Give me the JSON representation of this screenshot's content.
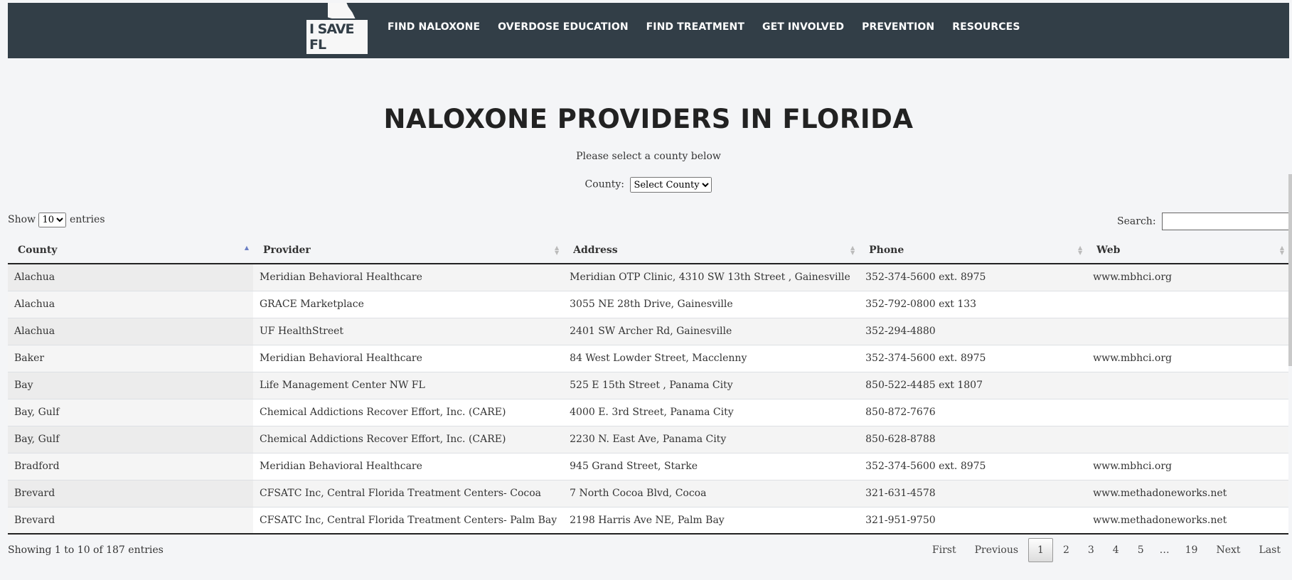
{
  "nav": {
    "logo_text": "I SAVE FL",
    "links": [
      {
        "label": "FIND NALOXONE"
      },
      {
        "label": "OVERDOSE EDUCATION"
      },
      {
        "label": "FIND TREATMENT"
      },
      {
        "label": "GET INVOLVED"
      },
      {
        "label": "PREVENTION"
      },
      {
        "label": "RESOURCES"
      }
    ]
  },
  "main": {
    "title": "NALOXONE PROVIDERS IN FLORIDA",
    "subtitle": "Please select a county below",
    "county_label": "County:",
    "county_selected": "Select County"
  },
  "table_controls": {
    "show_label": "Show",
    "entries_label": "entries",
    "length_selected": "10",
    "search_label": "Search:",
    "search_value": ""
  },
  "table": {
    "columns": [
      "County",
      "Provider",
      "Address",
      "Phone",
      "Web"
    ],
    "rows": [
      [
        "Alachua",
        "Meridian Behavioral Healthcare",
        "Meridian OTP Clinic, 4310 SW 13th Street , Gainesville",
        "352-374-5600 ext. 8975",
        "www.mbhci.org"
      ],
      [
        "Alachua",
        "GRACE Marketplace",
        "3055 NE 28th Drive, Gainesville",
        "352-792-0800 ext 133",
        ""
      ],
      [
        "Alachua",
        "UF HealthStreet",
        "2401 SW Archer Rd, Gainesville",
        "352-294-4880",
        ""
      ],
      [
        "Baker",
        "Meridian Behavioral Healthcare",
        "84 West Lowder Street, Macclenny",
        "352-374-5600 ext. 8975",
        "www.mbhci.org"
      ],
      [
        "Bay",
        "Life Management Center NW FL",
        "525 E 15th Street , Panama City",
        "850-522-4485 ext 1807",
        ""
      ],
      [
        "Bay, Gulf",
        "Chemical Addictions Recover Effort, Inc. (CARE)",
        "4000 E. 3rd Street, Panama City",
        "850-872-7676",
        ""
      ],
      [
        "Bay, Gulf",
        "Chemical Addictions Recover Effort, Inc. (CARE)",
        "2230 N. East Ave, Panama City",
        "850-628-8788",
        ""
      ],
      [
        "Bradford",
        "Meridian Behavioral Healthcare",
        "945 Grand Street, Starke",
        "352-374-5600 ext. 8975",
        "www.mbhci.org"
      ],
      [
        "Brevard",
        "CFSATC Inc, Central Florida Treatment Centers- Cocoa",
        "7 North Cocoa Blvd, Cocoa",
        "321-631-4578",
        "www.methadoneworks.net"
      ],
      [
        "Brevard",
        "CFSATC Inc, Central Florida Treatment Centers- Palm Bay",
        "2198 Harris Ave NE, Palm Bay",
        "321-951-9750",
        "www.methadoneworks.net"
      ]
    ]
  },
  "footer": {
    "info": "Showing 1 to 10 of 187 entries",
    "pagination": {
      "first": "First",
      "previous": "Previous",
      "pages": [
        "1",
        "2",
        "3",
        "4",
        "5"
      ],
      "ellipsis": "…",
      "last_page": "19",
      "next": "Next",
      "last": "Last",
      "current": "1"
    }
  },
  "colors": {
    "nav_bg": "#323e47",
    "page_bg": "#f4f5f7",
    "sort_active": "#6b7fc4"
  }
}
